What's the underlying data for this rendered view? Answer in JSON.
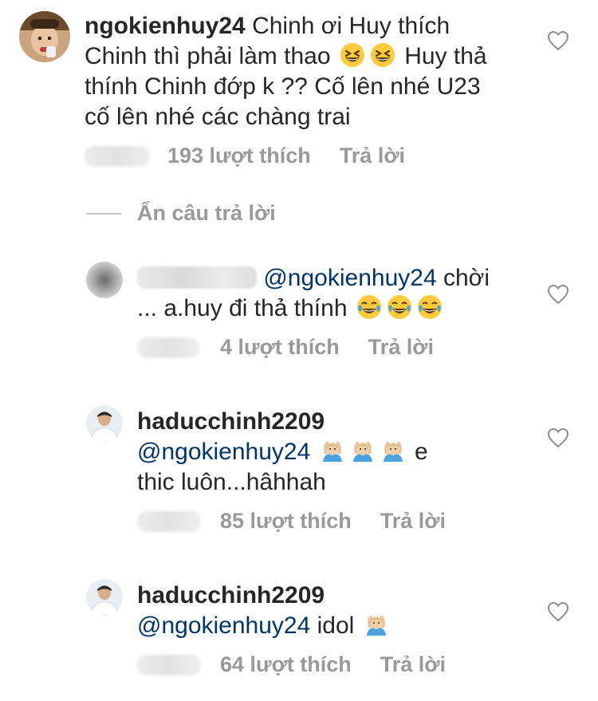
{
  "comments": [
    {
      "username": "ngokienhuy24",
      "text_parts": [
        "Chinh ơi Huy thích Chinh thì phải làm thao",
        "Huy thả thính Chinh đớp k ?? Cố lên nhé U23 cố lên nhé các chàng trai"
      ],
      "likes": "193 lượt thích",
      "reply": "Trả lời",
      "emoji": "grinning-squinting-face"
    },
    {
      "username": "",
      "mention": "@ngokienhuy24",
      "text_after_mention": "chời",
      "text_line2": "... a.huy đi thả thính",
      "likes": "4 lượt thích",
      "reply": "Trả lời",
      "emoji": "face-with-tears-of-joy"
    },
    {
      "username": "haducchinh2209",
      "mention": "@ngokienhuy24",
      "text_after_mention": "e",
      "text_line2": "thic luôn...hâhhah",
      "likes": "85 lượt thích",
      "reply": "Trả lời",
      "emoji": "person-gesturing-ok"
    },
    {
      "username": "haducchinh2209",
      "mention": "@ngokienhuy24",
      "text_after_mention": "idol",
      "likes": "64 lượt thích",
      "reply": "Trả lời",
      "emoji": "person-gesturing-ok"
    }
  ],
  "hide_replies_label": "Ẩn câu trả lời",
  "icons": {
    "like": "heart-outline-icon"
  },
  "colors": {
    "text": "#262626",
    "meta": "#999999",
    "mention": "#003569",
    "heart_stroke": "#8e8e8e"
  }
}
